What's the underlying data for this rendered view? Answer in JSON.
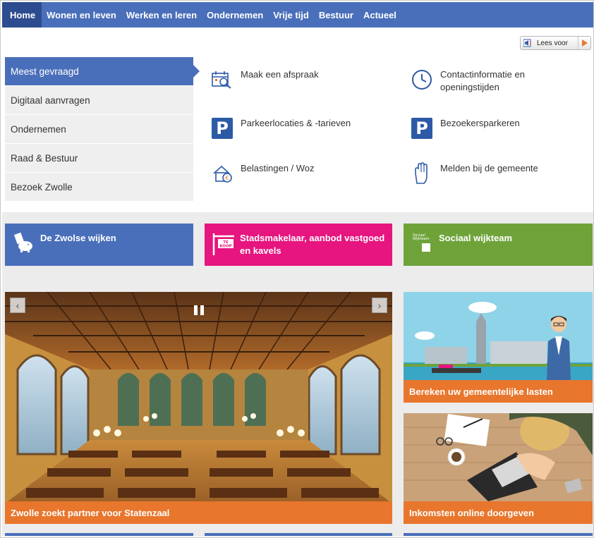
{
  "nav": {
    "items": [
      "Home",
      "Wonen en leven",
      "Werken en leren",
      "Ondernemen",
      "Vrije tijd",
      "Bestuur",
      "Actueel"
    ]
  },
  "readaloud": {
    "label": "Lees voor"
  },
  "sidemenu": {
    "items": [
      "Meest gevraagd",
      "Digitaal aanvragen",
      "Ondernemen",
      "Raad & Bestuur",
      "Bezoek Zwolle"
    ]
  },
  "quicklinks": {
    "appointment": "Maak een afspraak",
    "contact": "Contactinformatie en openingstijden",
    "parking_locations": "Parkeerlocaties & -tarieven",
    "visitor_parking": "Bezoekersparkeren",
    "taxes": "Belastingen / Woz",
    "report": "Melden bij de gemeente",
    "p_letter": "P"
  },
  "tiles": {
    "neighbourhoods": "De Zwolse wijken",
    "realestate": "Stadsmakelaar, aanbod vastgoed en kavels",
    "realestate_sign": "TE KOOP",
    "socialteam": "Sociaal wijkteam",
    "socialteam_logo": "Sociaal Wijkteam"
  },
  "carousel": {
    "caption": "Zwolle zoekt partner voor Statenzaal",
    "prev": "‹",
    "next": "›"
  },
  "cards": {
    "costs": "Bereken uw gemeentelijke lasten",
    "income": "Inkomsten online doorgeven"
  },
  "colors": {
    "nav_blue": "#4a6fba",
    "nav_active": "#2d4c8f",
    "pink": "#e6157f",
    "green": "#6fa33a",
    "orange": "#e8762c",
    "icon_blue": "#2d5aa6"
  }
}
